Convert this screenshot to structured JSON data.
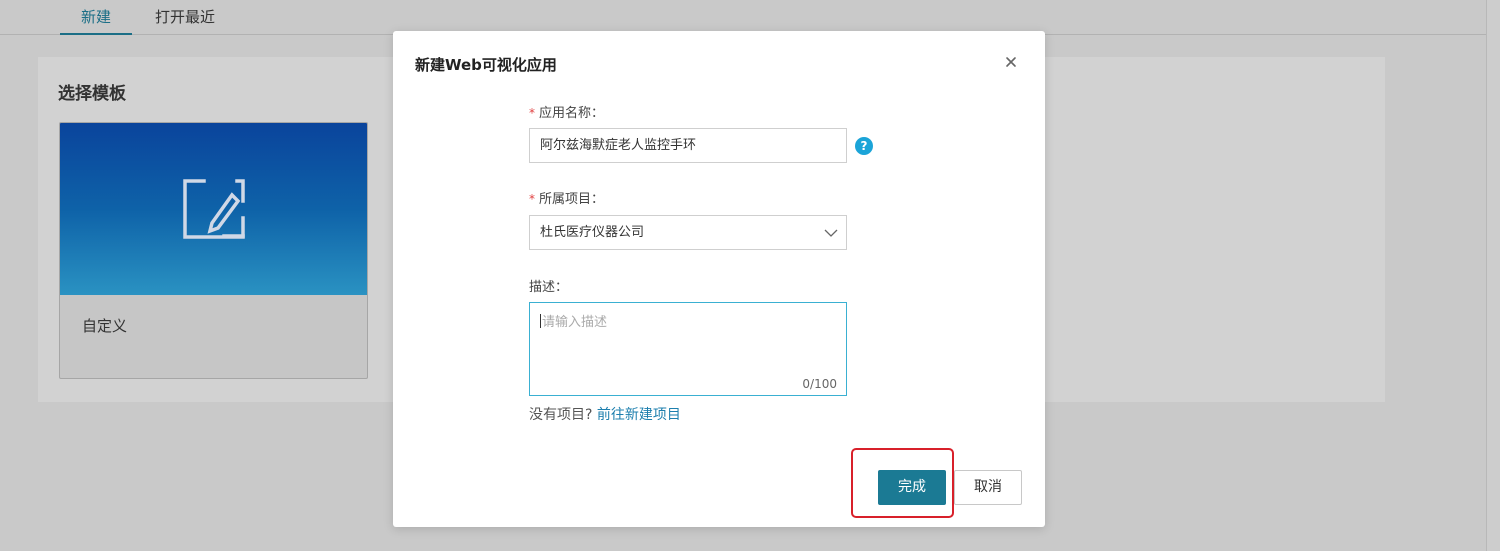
{
  "tabs": [
    {
      "label": "新建",
      "active": true
    },
    {
      "label": "打开最近",
      "active": false
    }
  ],
  "templates_panel": {
    "title": "选择模板",
    "cards": [
      {
        "label": "自定义",
        "icon": "edit-doc-icon"
      }
    ]
  },
  "modal": {
    "title": "新建Web可视化应用",
    "app_name": {
      "required_mark": "*",
      "label": "应用名称：",
      "value": "阿尔兹海默症老人监控手环",
      "help_glyph": "?"
    },
    "project": {
      "required_mark": "*",
      "label": "所属项目：",
      "selected": "杜氏医疗仪器公司"
    },
    "description": {
      "label": "描述：",
      "placeholder": "请输入描述",
      "counter": "0/100"
    },
    "hint": {
      "text": "没有项目?",
      "link": "前往新建项目"
    },
    "buttons": {
      "confirm": "完成",
      "cancel": "取消"
    }
  },
  "colors": {
    "accent": "#1b7a94",
    "link": "#1d7fae",
    "highlight": "#d8202a",
    "required": "#e04040",
    "help_icon": "#1ba4d8"
  }
}
